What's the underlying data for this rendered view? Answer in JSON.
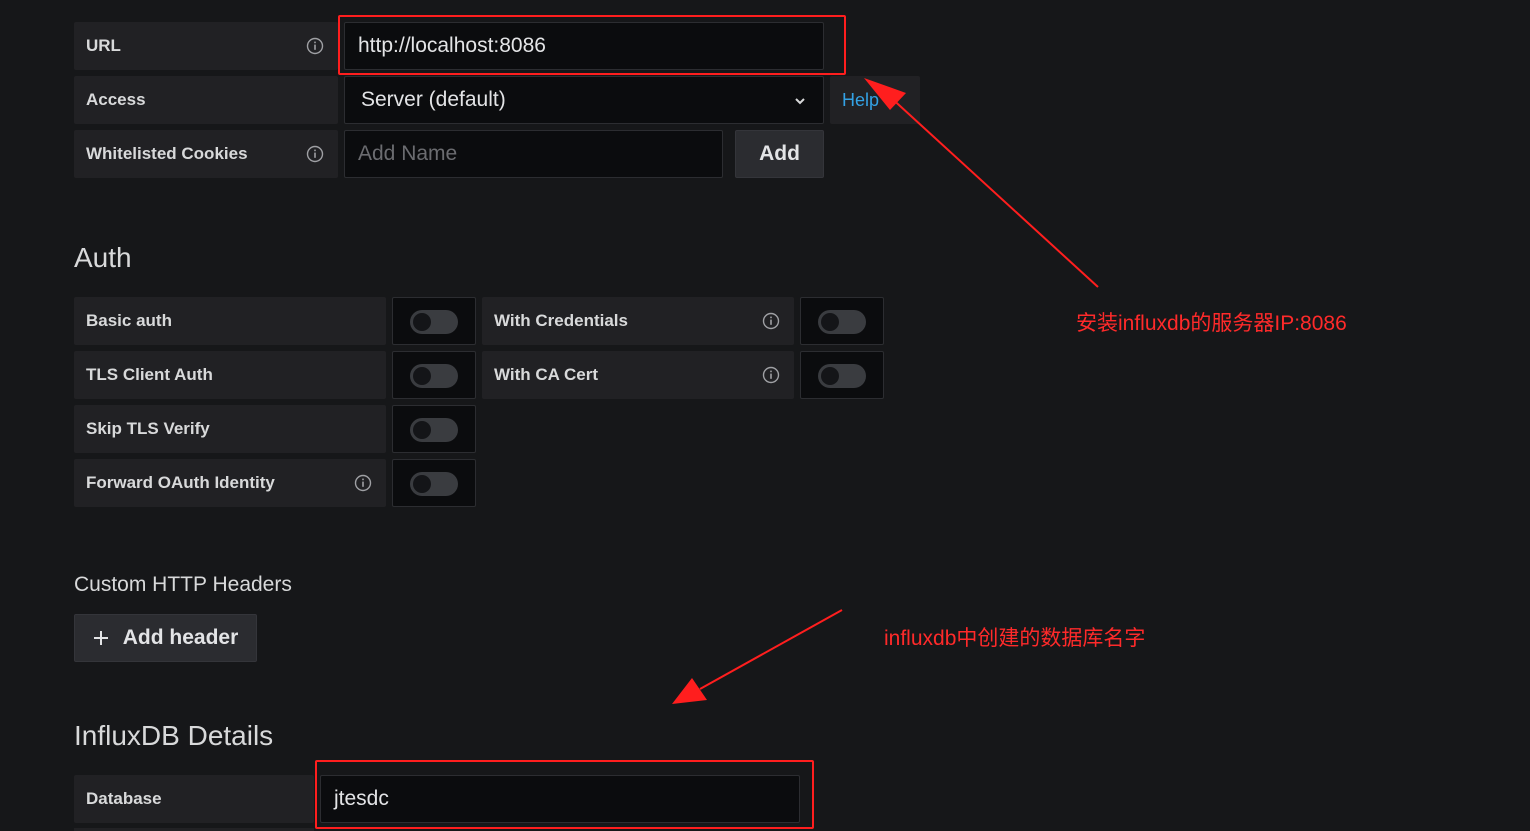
{
  "http": {
    "url": {
      "label": "URL",
      "value": "http://localhost:8086"
    },
    "access": {
      "label": "Access",
      "value": "Server (default)",
      "help": "Help"
    },
    "cookies": {
      "label": "Whitelisted Cookies",
      "placeholder": "Add Name",
      "add_label": "Add"
    }
  },
  "auth": {
    "title": "Auth",
    "basic_auth": "Basic auth",
    "with_credentials": "With Credentials",
    "tls_client_auth": "TLS Client Auth",
    "with_ca_cert": "With CA Cert",
    "skip_tls_verify": "Skip TLS Verify",
    "forward_oauth": "Forward OAuth Identity",
    "toggles": {
      "basic_auth": false,
      "with_credentials": false,
      "tls_client_auth": false,
      "with_ca_cert": false,
      "skip_tls_verify": false,
      "forward_oauth": false
    }
  },
  "custom_headers": {
    "title": "Custom HTTP Headers",
    "add_label": "Add header",
    "add_icon": "plus-icon"
  },
  "influx": {
    "title": "InfluxDB Details",
    "database_label": "Database",
    "database_value": "jtesdc"
  },
  "annotations": {
    "server_ip": "安装influxdb的服务器IP:8086",
    "database_name": "influxdb中创建的数据库名字",
    "color": "#ff1e1e"
  }
}
